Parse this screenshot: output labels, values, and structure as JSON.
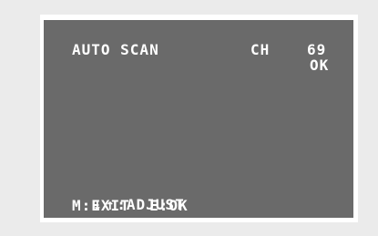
{
  "osd": {
    "title": "AUTO SCAN",
    "channel_label": "CH",
    "channel_number": "69",
    "status": "OK",
    "help": {
      "adjust_icons": [
        "arrow-down-icon",
        "arrow-up-icon"
      ],
      "adjust_text": ":ADJUST",
      "exit_text": "M:EXIT",
      "ok_text": "E:OK"
    }
  },
  "colors": {
    "screen_background": "#6a6a6a",
    "osd_text": "#ffffff",
    "frame": "#ffffff",
    "page_background": "#ebebeb"
  }
}
